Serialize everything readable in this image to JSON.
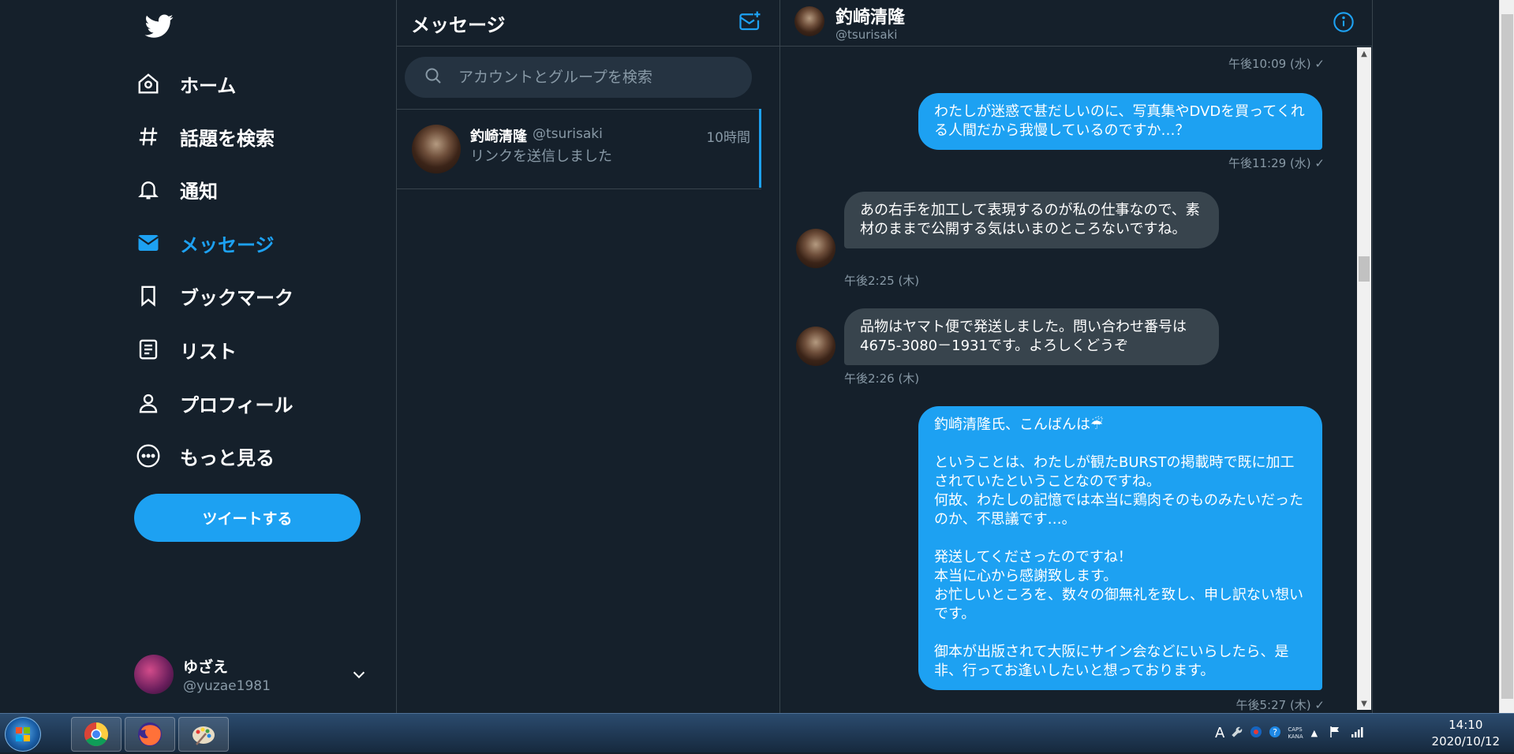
{
  "nav": {
    "items": [
      {
        "label": "ホーム",
        "icon": "home-icon"
      },
      {
        "label": "話題を検索",
        "icon": "hashtag-icon"
      },
      {
        "label": "通知",
        "icon": "bell-icon"
      },
      {
        "label": "メッセージ",
        "icon": "envelope-icon",
        "active": true
      },
      {
        "label": "ブックマーク",
        "icon": "bookmark-icon"
      },
      {
        "label": "リスト",
        "icon": "list-icon"
      },
      {
        "label": "プロフィール",
        "icon": "person-icon"
      },
      {
        "label": "もっと見る",
        "icon": "more-icon"
      }
    ],
    "tweet_button": "ツイートする",
    "account": {
      "name": "ゆざえ",
      "handle": "@yuzae1981"
    }
  },
  "list": {
    "title": "メッセージ",
    "search_placeholder": "アカウントとグループを検索",
    "conversation": {
      "name": "釣崎清隆",
      "handle": "@tsurisaki",
      "time": "10時間",
      "preview": "リンクを送信しました"
    }
  },
  "conversation": {
    "name": "釣崎清隆",
    "handle": "@tsurisaki",
    "messages": [
      {
        "from": "me",
        "timestamp": "午後10:09 (水) ✓"
      },
      {
        "from": "me",
        "text": "わたしが迷惑で甚だしいのに、写真集やDVDを買ってくれる人間だから我慢しているのですか…？",
        "timestamp": "午後11:29 (水) ✓"
      },
      {
        "from": "them",
        "text": "あの右手を加工して表現するのが私の仕事なので、素材のままで公開する気はいまのところないですね。",
        "timestamp": "午後2:25 (木)"
      },
      {
        "from": "them",
        "text": "品物はヤマト便で発送しました。問い合わせ番号は4675-3080－1931です。よろしくどうぞ",
        "timestamp": "午後2:26 (木)"
      },
      {
        "from": "me",
        "text": "釣崎清隆氏、こんばんは☔\n\nということは、わたしが観たBURSTの掲載時で既に加工されていたということなのですね。\n何故、わたしの記憶では本当に鶏肉そのものみたいだったのか、不思議です…。\n\n発送してくださったのですね！\n本当に心から感謝致します。\nお忙しいところを、数々の御無礼を致し、申し訳ない想いです。\n\n御本が出版されて大阪にサイン会などにいらしたら、是非、行ってお逢いしたいと想っております。",
        "timestamp": "午後5:27 (木) ✓"
      }
    ]
  },
  "taskbar": {
    "apps": [
      "chrome-icon",
      "firefox-icon",
      "paint-icon"
    ],
    "clock_time": "14:10",
    "clock_date": "2020/10/12",
    "tray": {
      "ime": "A",
      "caps": "CAPS",
      "kana": "KANA"
    }
  },
  "colors": {
    "background": "#15202b",
    "accent": "#1da1f2",
    "border": "#38444d",
    "muted": "#8899a6",
    "incoming_bubble": "#38444d"
  }
}
